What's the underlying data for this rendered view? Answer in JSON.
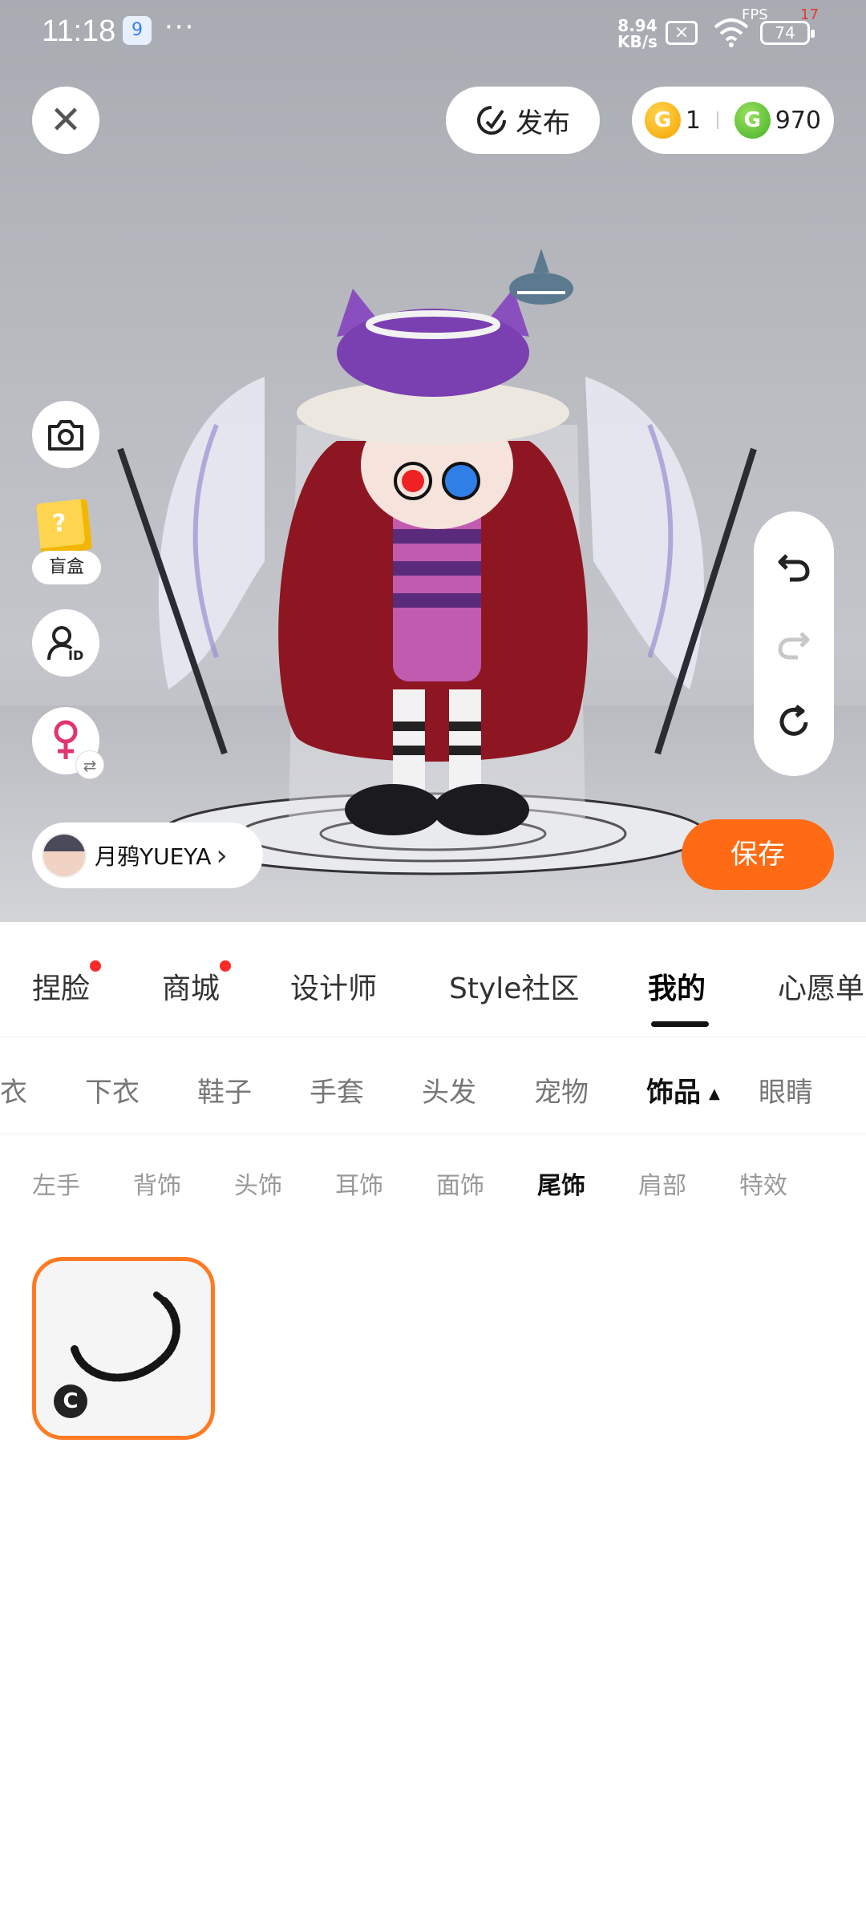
{
  "status_bar": {
    "time": "11:18",
    "app_badge": "9",
    "dots": "···",
    "speed_top": "8.94",
    "speed_bottom": "KB/s",
    "fps_label": "FPS",
    "fps_value": "17",
    "battery": "74"
  },
  "header": {
    "publish_label": "发布",
    "gold_coins": "1",
    "green_coins": "970"
  },
  "left_tools": {
    "blindbox_label": "盲盒"
  },
  "profile": {
    "name": "月鸦YUEYA"
  },
  "actions": {
    "save_label": "保存"
  },
  "main_tabs": [
    {
      "label": "捏脸",
      "badge": true
    },
    {
      "label": "商城",
      "badge": true
    },
    {
      "label": "设计师",
      "badge": false
    },
    {
      "label": "Style社区",
      "badge": false
    },
    {
      "label": "我的",
      "badge": false,
      "active": true
    },
    {
      "label": "心愿单",
      "badge": false
    }
  ],
  "sub_tabs": [
    {
      "label": "上衣"
    },
    {
      "label": "下衣"
    },
    {
      "label": "鞋子"
    },
    {
      "label": "手套"
    },
    {
      "label": "头发"
    },
    {
      "label": "宠物"
    },
    {
      "label": "饰品",
      "active": true
    },
    {
      "label": "眼睛"
    }
  ],
  "third_tabs": [
    {
      "label": "左手"
    },
    {
      "label": "背饰"
    },
    {
      "label": "头饰"
    },
    {
      "label": "耳饰"
    },
    {
      "label": "面饰"
    },
    {
      "label": "尾饰",
      "active": true
    },
    {
      "label": "肩部"
    },
    {
      "label": "特效"
    }
  ],
  "items": [
    {
      "badge": "C",
      "selected": true
    }
  ],
  "colors": {
    "accent": "#ff6a14",
    "badge_red": "#ff2a2a",
    "gold": "#f5a300",
    "green": "#43b02a"
  }
}
